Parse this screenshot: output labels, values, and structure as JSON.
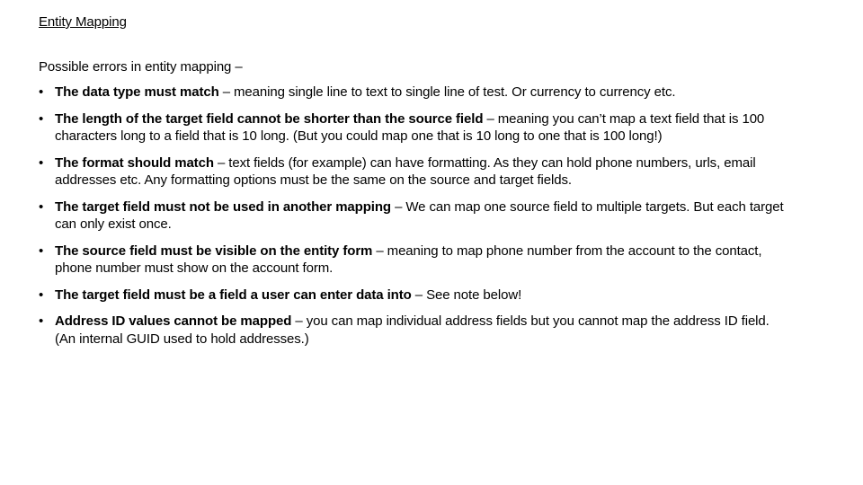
{
  "slide": {
    "title": "Entity Mapping",
    "intro": "Possible errors in entity mapping –",
    "bullet_glyph": "•",
    "bullets": [
      {
        "bold": "The data type must match",
        "text": " – meaning single line to text to single line of test. Or currency to currency etc."
      },
      {
        "bold": "The length of the target field cannot be shorter than the source field",
        "text": " – meaning you can’t map a text field that is 100 characters long to a field that is 10 long. (But you could map one that is 10 long to one that is 100 long!)"
      },
      {
        "bold": "The format should match",
        "text": " – text fields (for example) can have formatting. As they can hold phone numbers, urls, email addresses etc. Any formatting options must be the same on the source and target fields."
      },
      {
        "bold": "The target field must not be used in another mapping",
        "text": " – We can map one source field to multiple targets. But each target can only exist once."
      },
      {
        "bold": "The source field must be visible on the entity form",
        "text": " – meaning to map phone number from the account to the contact, phone number must show on the account form."
      },
      {
        "bold": "The target field must be a field a user can enter data into",
        "text": " – See note below!"
      },
      {
        "bold": "Address ID values cannot be mapped",
        "text": " – you can map individual address fields but you cannot map the address ID field. (An internal GUID used to hold addresses.)"
      }
    ]
  }
}
